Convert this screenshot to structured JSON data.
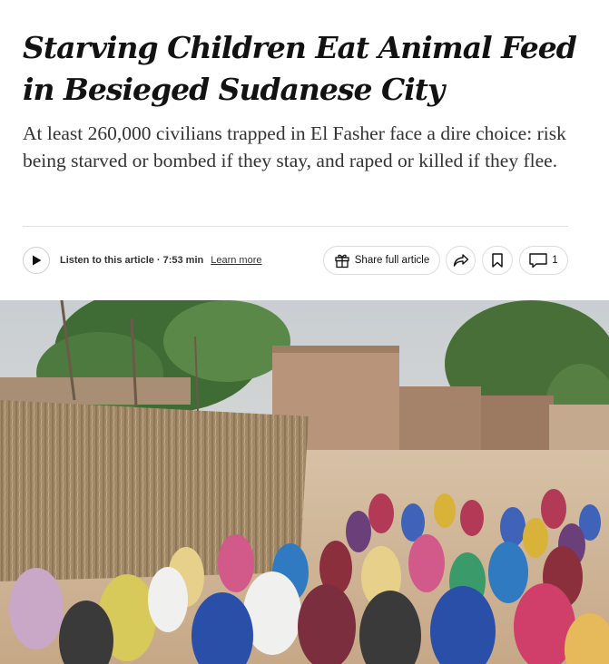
{
  "article": {
    "headline": "Starving Children Eat Animal Feed in Besieged Sudanese City",
    "summary": "At least 260,000 civilians trapped in El Fasher face a dire choice: risk being starved or bombed if they stay, and raped or killed if they flee."
  },
  "audio": {
    "listen_label": "Listen to this article",
    "separator": "·",
    "duration": "7:53 min",
    "learn_more": "Learn more"
  },
  "actions": {
    "share_full_article": "Share full article",
    "comment_count": "1"
  },
  "icons": {
    "play": "play-icon",
    "gift": "gift-icon",
    "share": "share-arrow-icon",
    "bookmark": "bookmark-icon",
    "comment": "comment-bubble-icon"
  },
  "colors": {
    "text": "#121212",
    "summary_text": "#333333",
    "border": "#dcdcdc"
  }
}
